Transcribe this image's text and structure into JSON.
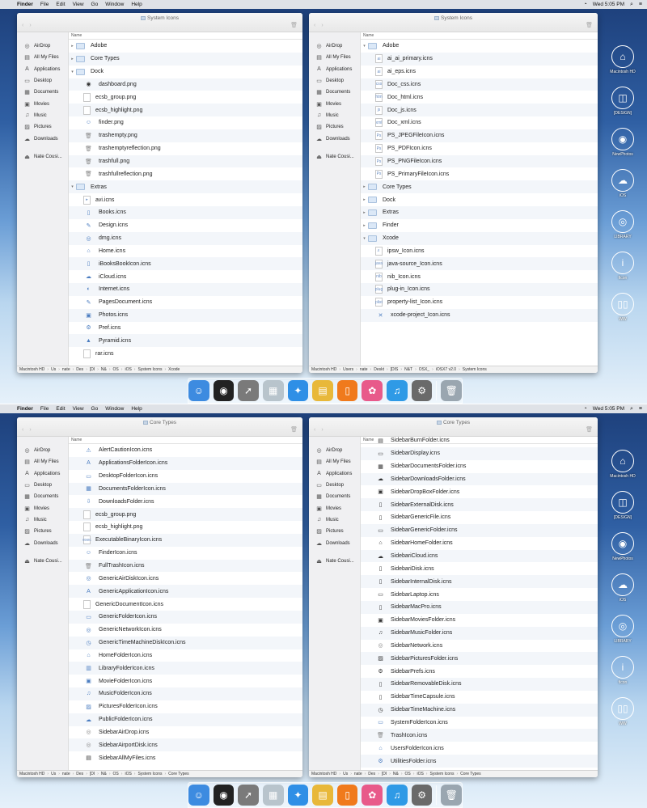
{
  "menubar": {
    "apple": "",
    "items": [
      "Finder",
      "File",
      "Edit",
      "View",
      "Go",
      "Window",
      "Help"
    ],
    "clock": "Wed 5:05 PM",
    "wifi_glyph": "◔",
    "search_glyph": "⌕",
    "list_glyph": "≡"
  },
  "icons": {
    "back": "‹",
    "forward": "›",
    "trash": "🗑"
  },
  "sidebar": {
    "items": [
      {
        "icon": "◎",
        "label": "AirDrop"
      },
      {
        "icon": "▤",
        "label": "All My Files"
      },
      {
        "icon": "A",
        "label": "Applications"
      },
      {
        "icon": "▭",
        "label": "Desktop"
      },
      {
        "icon": "▦",
        "label": "Documents"
      },
      {
        "icon": "▣",
        "label": "Movies"
      },
      {
        "icon": "♫",
        "label": "Music"
      },
      {
        "icon": "▨",
        "label": "Pictures"
      },
      {
        "icon": "☁",
        "label": "Downloads"
      }
    ],
    "device": {
      "icon": "⏏",
      "label": "Nate Cousi..."
    }
  },
  "column_header": "Name",
  "windows": {
    "tl": {
      "title": "System Icons",
      "rows": [
        {
          "level": 1,
          "tri": "▸",
          "icon": "folder",
          "name": "Adobe"
        },
        {
          "level": 1,
          "tri": "▸",
          "icon": "folder",
          "name": "Core Types"
        },
        {
          "level": 1,
          "tri": "▾",
          "icon": "folder",
          "name": "Dock"
        },
        {
          "level": 2,
          "icon": "dark",
          "glyph": "◉",
          "name": "dashboard.png"
        },
        {
          "level": 2,
          "icon": "doc",
          "glyph": "",
          "name": "ecsb_group.png"
        },
        {
          "level": 2,
          "icon": "doc",
          "glyph": "",
          "name": "ecsb_highlight.png"
        },
        {
          "level": 2,
          "icon": "plain",
          "glyph": "☺",
          "name": "finder.png"
        },
        {
          "level": 2,
          "icon": "grey",
          "glyph": "🗑",
          "name": "trashempty.png"
        },
        {
          "level": 2,
          "icon": "grey",
          "glyph": "🗑",
          "name": "trashemptyreflection.png"
        },
        {
          "level": 2,
          "icon": "grey",
          "glyph": "🗑",
          "name": "trashfull.png"
        },
        {
          "level": 2,
          "icon": "grey",
          "glyph": "🗑",
          "name": "trashfullreflection.png"
        },
        {
          "level": 1,
          "tri": "▾",
          "icon": "folder",
          "name": "Extras"
        },
        {
          "level": 2,
          "icon": "doc",
          "glyph": "▸",
          "name": "avi.icns"
        },
        {
          "level": 2,
          "icon": "plain",
          "glyph": "▯",
          "name": "Books.icns"
        },
        {
          "level": 2,
          "icon": "plain",
          "glyph": "✎",
          "name": "Design.icns"
        },
        {
          "level": 2,
          "icon": "plain",
          "glyph": "◎",
          "name": "dmg.icns"
        },
        {
          "level": 2,
          "icon": "plain",
          "glyph": "⌂",
          "name": "Home.icns"
        },
        {
          "level": 2,
          "icon": "plain",
          "glyph": "▯",
          "name": "iBooksBookIcon.icns"
        },
        {
          "level": 2,
          "icon": "plain",
          "glyph": "☁",
          "name": "iCloud.icns"
        },
        {
          "level": 2,
          "icon": "plain",
          "glyph": "◐",
          "name": "Internet.icns"
        },
        {
          "level": 2,
          "icon": "plain",
          "glyph": "✎",
          "name": "PagesDocument.icns"
        },
        {
          "level": 2,
          "icon": "plain",
          "glyph": "▣",
          "name": "Photos.icns"
        },
        {
          "level": 2,
          "icon": "plain",
          "glyph": "⚙",
          "name": "Pref.icns"
        },
        {
          "level": 2,
          "icon": "plain",
          "glyph": "▲",
          "name": "Pyramid.icns"
        },
        {
          "level": 2,
          "icon": "doc",
          "glyph": "",
          "name": "rar.icns"
        }
      ],
      "path": [
        "Macintosh HD",
        "Us",
        "nate",
        "Des",
        "[DI",
        "N&",
        "OS",
        "iOS",
        "System Icons",
        "Xcode"
      ]
    },
    "tr": {
      "title": "System Icons",
      "rows": [
        {
          "level": 1,
          "tri": "▾",
          "icon": "folder",
          "name": "Adobe"
        },
        {
          "level": 2,
          "icon": "doc",
          "glyph": "ai",
          "name": "ai_ai_primary.icns"
        },
        {
          "level": 2,
          "icon": "doc",
          "glyph": "ai",
          "name": "ai_eps.icns"
        },
        {
          "level": 2,
          "icon": "doc",
          "glyph": "css",
          "name": "Doc_css.icns"
        },
        {
          "level": 2,
          "icon": "doc",
          "glyph": "htm",
          "name": "Doc_html.icns"
        },
        {
          "level": 2,
          "icon": "doc",
          "glyph": "js",
          "name": "Doc_js.icns"
        },
        {
          "level": 2,
          "icon": "doc",
          "glyph": "xml",
          "name": "Doc_xml.icns"
        },
        {
          "level": 2,
          "icon": "doc",
          "glyph": "Ps",
          "name": "PS_JPEGFileIcon.icns"
        },
        {
          "level": 2,
          "icon": "doc",
          "glyph": "Ps",
          "name": "PS_PDFIcon.icns"
        },
        {
          "level": 2,
          "icon": "doc",
          "glyph": "Ps",
          "name": "PS_PNGFileIcon.icns"
        },
        {
          "level": 2,
          "icon": "doc",
          "glyph": "Ps",
          "name": "PS_PrimaryFileIcon.icns"
        },
        {
          "level": 1,
          "tri": "▸",
          "icon": "folder",
          "name": "Core Types"
        },
        {
          "level": 1,
          "tri": "▸",
          "icon": "folder",
          "name": "Dock"
        },
        {
          "level": 1,
          "tri": "▸",
          "icon": "folder",
          "name": "Extras"
        },
        {
          "level": 1,
          "tri": "▸",
          "icon": "folder",
          "name": "Finder"
        },
        {
          "level": 1,
          "tri": "▾",
          "icon": "folder",
          "name": "Xcode"
        },
        {
          "level": 2,
          "icon": "doc",
          "glyph": "♬",
          "name": "ipsw_Icon.icns"
        },
        {
          "level": 2,
          "icon": "doc",
          "glyph": "java",
          "name": "java-source_Icon.icns"
        },
        {
          "level": 2,
          "icon": "doc",
          "glyph": "nib",
          "name": "nib_Icon.icns"
        },
        {
          "level": 2,
          "icon": "doc",
          "glyph": "plug",
          "name": "plug-in_Icon.icns"
        },
        {
          "level": 2,
          "icon": "doc",
          "glyph": "plist",
          "name": "property-list_Icon.icns"
        },
        {
          "level": 2,
          "icon": "plain",
          "glyph": "✕",
          "name": "xcode-project_Icon.icns"
        }
      ],
      "path": [
        "Macintosh HD",
        "Users",
        "nate",
        "Deskt",
        "[DIS",
        "N&T",
        "OSX_",
        "iOSX7 v2.0",
        "System Icons"
      ]
    },
    "bl": {
      "title": "Core Types",
      "rows": [
        {
          "level": 2,
          "icon": "plain",
          "glyph": "⚠",
          "name": "AlertCautionIcon.icns"
        },
        {
          "level": 2,
          "icon": "plain",
          "glyph": "A",
          "name": "ApplicationsFolderIcon.icns"
        },
        {
          "level": 2,
          "icon": "plain",
          "glyph": "▭",
          "name": "DesktopFolderIcon.icns"
        },
        {
          "level": 2,
          "icon": "plain",
          "glyph": "▦",
          "name": "DocumentsFolderIcon.icns"
        },
        {
          "level": 2,
          "icon": "plain",
          "glyph": "⇩",
          "name": "DownloadsFolder.icns"
        },
        {
          "level": 2,
          "icon": "doc",
          "glyph": "",
          "name": "ecsb_group.png"
        },
        {
          "level": 2,
          "icon": "doc",
          "glyph": "",
          "name": "ecsb_highlight.png"
        },
        {
          "level": 2,
          "icon": "doc",
          "glyph": "exec",
          "name": "ExecutableBinaryIcon.icns"
        },
        {
          "level": 2,
          "icon": "plain",
          "glyph": "☺",
          "name": "FinderIcon.icns"
        },
        {
          "level": 2,
          "icon": "grey",
          "glyph": "🗑",
          "name": "FullTrashIcon.icns"
        },
        {
          "level": 2,
          "icon": "plain",
          "glyph": "◎",
          "name": "GenericAirDiskIcon.icns"
        },
        {
          "level": 2,
          "icon": "plain",
          "glyph": "A",
          "name": "GenericApplicationIcon.icns"
        },
        {
          "level": 2,
          "icon": "doc",
          "glyph": "",
          "name": "GenericDocumentIcon.icns"
        },
        {
          "level": 2,
          "icon": "plain",
          "glyph": "▭",
          "name": "GenericFolderIcon.icns"
        },
        {
          "level": 2,
          "icon": "plain",
          "glyph": "◎",
          "name": "GenericNetworkIcon.icns"
        },
        {
          "level": 2,
          "icon": "plain",
          "glyph": "◷",
          "name": "GenericTimeMachineDiskIcon.icns"
        },
        {
          "level": 2,
          "icon": "plain",
          "glyph": "⌂",
          "name": "HomeFolderIcon.icns"
        },
        {
          "level": 2,
          "icon": "plain",
          "glyph": "▥",
          "name": "LibraryFolderIcon.icns"
        },
        {
          "level": 2,
          "icon": "plain",
          "glyph": "▣",
          "name": "MovieFolderIcon.icns"
        },
        {
          "level": 2,
          "icon": "plain",
          "glyph": "♫",
          "name": "MusicFolderIcon.icns"
        },
        {
          "level": 2,
          "icon": "plain",
          "glyph": "▨",
          "name": "PicturesFolderIcon.icns"
        },
        {
          "level": 2,
          "icon": "plain",
          "glyph": "☁",
          "name": "PublicFolderIcon.icns"
        },
        {
          "level": 2,
          "icon": "grey",
          "glyph": "◎",
          "name": "SidebarAirDrop.icns"
        },
        {
          "level": 2,
          "icon": "grey",
          "glyph": "◎",
          "name": "SidebarAirportDisk.icns"
        },
        {
          "level": 2,
          "icon": "dark",
          "glyph": "▤",
          "name": "SidebarAllMyFiles.icns"
        }
      ],
      "path": [
        "Macintosh HD",
        "Us",
        "nate",
        "Des",
        "[DI",
        "N&",
        "OS",
        "iOS",
        "System Icons",
        "Core Types"
      ]
    },
    "br": {
      "title": "Core Types",
      "rows": [
        {
          "level": 2,
          "icon": "dark",
          "glyph": "▤",
          "name": "SidebarBurnFolder.icns"
        },
        {
          "level": 2,
          "icon": "dark",
          "glyph": "▭",
          "name": "SidebarDisplay.icns"
        },
        {
          "level": 2,
          "icon": "dark",
          "glyph": "▦",
          "name": "SidebarDocumentsFolder.icns"
        },
        {
          "level": 2,
          "icon": "dark",
          "glyph": "☁",
          "name": "SidebarDownloadsFolder.icns"
        },
        {
          "level": 2,
          "icon": "dark",
          "glyph": "▣",
          "name": "SidebarDropBoxFolder.icns"
        },
        {
          "level": 2,
          "icon": "dark",
          "glyph": "▯",
          "name": "SidebarExternalDisk.icns"
        },
        {
          "level": 2,
          "icon": "dark",
          "glyph": "▯",
          "name": "SidebarGenericFile.icns"
        },
        {
          "level": 2,
          "icon": "dark",
          "glyph": "▭",
          "name": "SidebarGenericFolder.icns"
        },
        {
          "level": 2,
          "icon": "dark",
          "glyph": "⌂",
          "name": "SidebarHomeFolder.icns"
        },
        {
          "level": 2,
          "icon": "dark",
          "glyph": "☁",
          "name": "SidebariCloud.icns"
        },
        {
          "level": 2,
          "icon": "dark",
          "glyph": "▯",
          "name": "SidebariDisk.icns"
        },
        {
          "level": 2,
          "icon": "dark",
          "glyph": "▯",
          "name": "SidebarInternalDisk.icns"
        },
        {
          "level": 2,
          "icon": "dark",
          "glyph": "▭",
          "name": "SidebarLaptop.icns"
        },
        {
          "level": 2,
          "icon": "dark",
          "glyph": "▯",
          "name": "SidebarMacPro.icns"
        },
        {
          "level": 2,
          "icon": "dark",
          "glyph": "▣",
          "name": "SidebarMoviesFolder.icns"
        },
        {
          "level": 2,
          "icon": "dark",
          "glyph": "♫",
          "name": "SidebarMusicFolder.icns"
        },
        {
          "level": 2,
          "icon": "grey",
          "glyph": "◎",
          "name": "SidebarNetwork.icns"
        },
        {
          "level": 2,
          "icon": "dark",
          "glyph": "▨",
          "name": "SidebarPicturesFolder.icns"
        },
        {
          "level": 2,
          "icon": "dark",
          "glyph": "⚙",
          "name": "SidebarPrefs.icns"
        },
        {
          "level": 2,
          "icon": "dark",
          "glyph": "▯",
          "name": "SidebarRemovableDisk.icns"
        },
        {
          "level": 2,
          "icon": "dark",
          "glyph": "▯",
          "name": "SidebarTimeCapsule.icns"
        },
        {
          "level": 2,
          "icon": "dark",
          "glyph": "◷",
          "name": "SidebarTimeMachine.icns"
        },
        {
          "level": 2,
          "icon": "plain",
          "glyph": "▭",
          "name": "SystemFolderIcon.icns"
        },
        {
          "level": 2,
          "icon": "grey",
          "glyph": "🗑",
          "name": "TrashIcon.icns"
        },
        {
          "level": 2,
          "icon": "plain",
          "glyph": "⌂",
          "name": "UsersFolderIcon.icns"
        },
        {
          "level": 2,
          "icon": "plain",
          "glyph": "⚙",
          "name": "UtilitiesFolder.icns"
        }
      ],
      "path": [
        "Macintosh HD",
        "Us",
        "nate",
        "Des",
        "[DI",
        "N&",
        "OS",
        "iOS",
        "System Icons",
        "Core Types"
      ]
    }
  },
  "desktop_icons": [
    {
      "glyph": "⌂",
      "label": "Macintosh HD"
    },
    {
      "glyph": "◫",
      "label": "[DESIGN]"
    },
    {
      "glyph": "◉",
      "label": "NewPhotos"
    },
    {
      "glyph": "☁",
      "label": "iOS"
    },
    {
      "glyph": "◎",
      "label": "LIBRARY"
    },
    {
      "glyph": "i",
      "label": "ficon"
    },
    {
      "glyph": "▯▯",
      "label": "WW"
    }
  ],
  "dock": [
    {
      "name": "finder",
      "glyph": "☺",
      "color": "#3d8be0"
    },
    {
      "name": "dashboard",
      "glyph": "◉",
      "color": "#222222"
    },
    {
      "name": "launchpad",
      "glyph": "➚",
      "color": "#7a7a7a"
    },
    {
      "name": "mission-control",
      "glyph": "▦",
      "color": "#b8c4cc"
    },
    {
      "name": "safari",
      "glyph": "✦",
      "color": "#2f8fe6"
    },
    {
      "name": "photo-booth",
      "glyph": "▤",
      "color": "#e8b83a"
    },
    {
      "name": "ibooks",
      "glyph": "▯",
      "color": "#f07a1c"
    },
    {
      "name": "photos",
      "glyph": "✿",
      "color": "#e85a8a"
    },
    {
      "name": "itunes",
      "glyph": "♫",
      "color": "#2f9ae6"
    },
    {
      "name": "system-preferences",
      "glyph": "⚙",
      "color": "#6a6a6a"
    },
    {
      "name": "trash",
      "glyph": "🗑",
      "color": "#9aa6b0"
    }
  ]
}
